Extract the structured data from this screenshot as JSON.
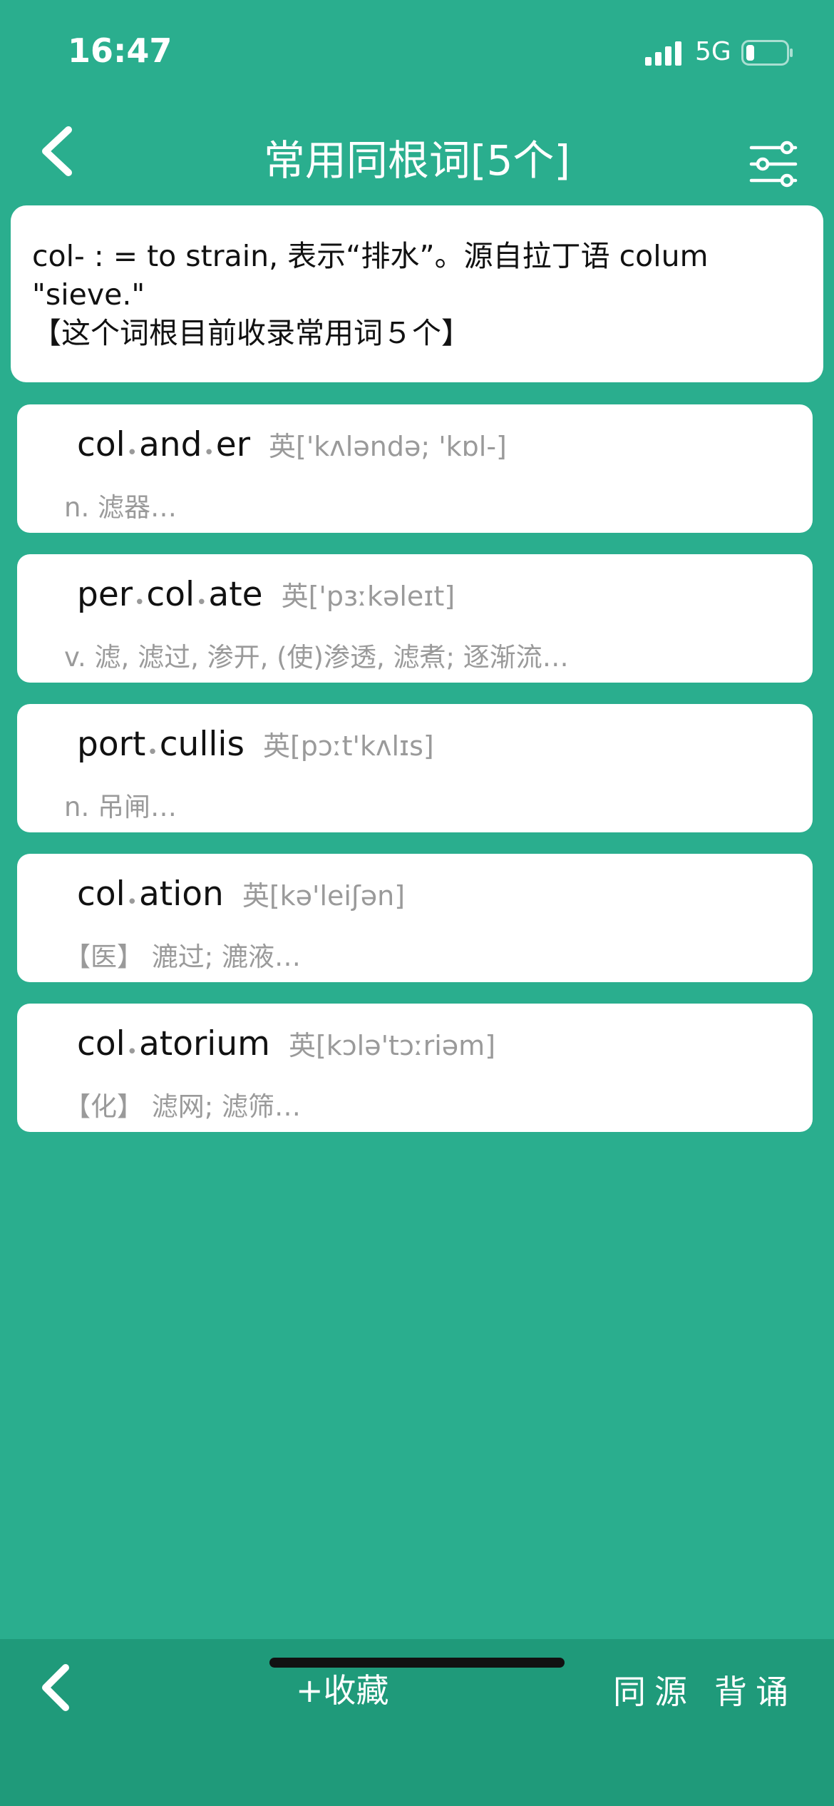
{
  "status_bar": {
    "time": "16:47",
    "network": "5G",
    "signal_icon": "cellular-signal-icon",
    "battery_icon": "battery-low-icon"
  },
  "nav": {
    "title": "常用同根词[5个]",
    "back_icon": "chevron-left-icon",
    "filter_icon": "filter-sliders-icon"
  },
  "root": {
    "line1": "col- : = to strain, 表示“排水”。源自拉丁语 colum",
    "line2": "\"sieve.\"",
    "line3": "【这个词根目前收录常用词５个】"
  },
  "words": [
    {
      "parts": [
        "col",
        "and",
        "er"
      ],
      "phonetic": "英['kʌləndə; 'kɒl-]",
      "meaning": "n. 滤器…"
    },
    {
      "parts": [
        "per",
        "col",
        "ate"
      ],
      "phonetic": "英['pɜːkəleɪt]",
      "meaning": "v. 滤, 滤过, 渗开, (使)渗透, 滤煮; 逐渐流…"
    },
    {
      "parts": [
        "port",
        "cullis"
      ],
      "phonetic": "英[pɔːt'kʌlɪs]",
      "meaning": "n. 吊闸…"
    },
    {
      "parts": [
        "col",
        "ation"
      ],
      "phonetic": "英[kə'leiʃən]",
      "meaning": "【医】 漉过; 漉液…"
    },
    {
      "parts": [
        "col",
        "atorium"
      ],
      "phonetic": "英[kɔlə'tɔːriəm]",
      "meaning": "【化】 滤网; 滤筛…"
    }
  ],
  "bottom_bar": {
    "back_icon": "chevron-left-icon",
    "favorite_label": "+收藏",
    "same_source_label": "同源",
    "recite_label": "背诵"
  },
  "colors": {
    "background": "#2aae8e",
    "bottom_bar": "#1f9a7a",
    "card": "#ffffff",
    "secondary_text": "#9a9a9a"
  }
}
